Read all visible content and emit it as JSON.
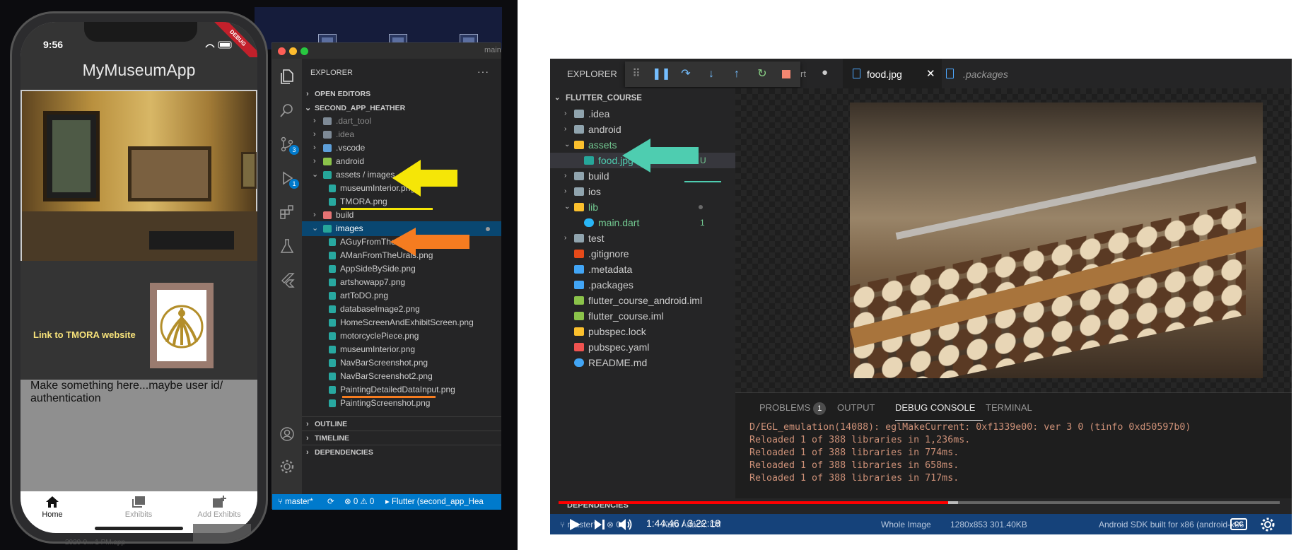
{
  "left": {
    "phone": {
      "time": "9:56",
      "debug_banner": "DEBUG",
      "app_title": "MyMuseumApp",
      "link_text": "Link to TMORA website",
      "placeholder_text": "Make something here...maybe user id/ authentication",
      "nav": [
        {
          "label": "Home",
          "icon": "home-icon",
          "active": true
        },
        {
          "label": "Exhibits",
          "icon": "photo-library-icon",
          "active": false
        },
        {
          "label": "Add Exhibits",
          "icon": "add-photo-icon",
          "active": false
        }
      ]
    },
    "vscode": {
      "explorer_title": "EXPLORER",
      "more": "···",
      "sections": {
        "open_editors": "OPEN EDITORS",
        "project": "SECOND_APP_HEATHER",
        "outline": "OUTLINE",
        "timeline": "TIMELINE",
        "dependencies": "DEPENDENCIES"
      },
      "tree": {
        "dart_tool": ".dart_tool",
        "idea": ".idea",
        "vscode": ".vscode",
        "android": "android",
        "assets_images": "assets / images",
        "museum_interior_1": "museumInterior.png",
        "tmora": "TMORA.png",
        "build": "build",
        "images": "images",
        "images_files": [
          "AGuyFromTheUrals.png",
          "AManFromTheUrals.png",
          "AppSideBySide.png",
          "artshowapp7.png",
          "artToDO.png",
          "databaseImage2.png",
          "HomeScreenAndExhibitScreen.png",
          "motorcyclePiece.png",
          "museumInterior.png",
          "NavBarScreenshot.png",
          "NavBarScreenshot2.png",
          "PaintingDetailedDataInput.png",
          "PaintingScreenshot.png"
        ]
      },
      "badges": {
        "source_control": "3",
        "run_debug": "1"
      },
      "partial_tab": "main",
      "status": {
        "branch": "master*",
        "problems": "⊗ 0 ⚠ 0",
        "flutter": "Flutter (second_app_Hea"
      }
    },
    "desktop_text": "2020-9... 1 PM.app"
  },
  "right": {
    "explorer_label": "EXPLORER",
    "tabs": {
      "partial": "rt",
      "food": "food.jpg",
      "packages": ".packages"
    },
    "project": "FLUTTER_COURSE",
    "tree": [
      {
        "label": ".idea",
        "kind": "folder",
        "chevron": "›"
      },
      {
        "label": "android",
        "kind": "folder",
        "chevron": "›"
      },
      {
        "label": "assets",
        "kind": "folder-open",
        "chevron": "⌄"
      },
      {
        "label": "food.jpg",
        "kind": "image",
        "badge": "U"
      },
      {
        "label": "build",
        "kind": "folder",
        "chevron": "›"
      },
      {
        "label": "ios",
        "kind": "folder",
        "chevron": "›"
      },
      {
        "label": "lib",
        "kind": "folder-open",
        "chevron": "⌄"
      },
      {
        "label": "main.dart",
        "kind": "dart",
        "badge": "1"
      },
      {
        "label": "test",
        "kind": "folder",
        "chevron": "›"
      },
      {
        "label": ".gitignore",
        "kind": "git"
      },
      {
        "label": ".metadata",
        "kind": "file"
      },
      {
        "label": ".packages",
        "kind": "file"
      },
      {
        "label": "flutter_course_android.iml",
        "kind": "iml"
      },
      {
        "label": "flutter_course.iml",
        "kind": "iml"
      },
      {
        "label": "pubspec.lock",
        "kind": "lock"
      },
      {
        "label": "pubspec.yaml",
        "kind": "yaml"
      },
      {
        "label": "README.md",
        "kind": "info"
      }
    ],
    "panel_tabs": {
      "problems": "PROBLEMS",
      "problems_count": "1",
      "output": "OUTPUT",
      "debug_console": "DEBUG CONSOLE",
      "terminal": "TERMINAL"
    },
    "console_lines": [
      "D/EGL_emulation(14088): eglMakeCurrent: 0xf1339e00: ver 3 0 (tinfo 0xd50597b0)",
      "Reloaded 1 of 388 libraries in 1,236ms.",
      "Reloaded 1 of 388 libraries in 774ms.",
      "Reloaded 1 of 388 libraries in 658ms.",
      "Reloaded 1 of 388 libraries in 717ms."
    ],
    "dependencies": "DEPENDENCIES",
    "video": {
      "time": "1:44:46 / 3:22:18",
      "progress": 0.54
    },
    "status": {
      "branch": "master*",
      "problems": "⊗ 0",
      "auto_attach": "Auto Attach: Off",
      "whole_image": "Whole Image",
      "image_info": "1280x853 301.40KB",
      "sdk": "Android SDK built for x86 (android-x86"
    }
  }
}
